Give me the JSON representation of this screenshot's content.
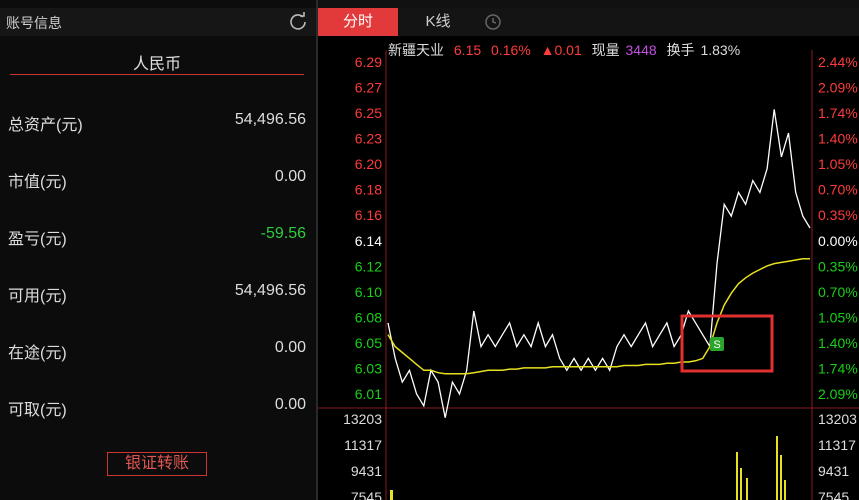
{
  "account": {
    "title": "账号信息",
    "currency": "人民币",
    "rows": [
      {
        "label": "总资产(元)",
        "value": "54,496.56",
        "color": "normal"
      },
      {
        "label": "市值(元)",
        "value": "0.00",
        "color": "normal"
      },
      {
        "label": "盈亏(元)",
        "value": "-59.56",
        "color": "green"
      },
      {
        "label": "可用(元)",
        "value": "54,496.56",
        "color": "normal"
      },
      {
        "label": "在途(元)",
        "value": "0.00",
        "color": "normal"
      },
      {
        "label": "可取(元)",
        "value": "0.00",
        "color": "normal"
      }
    ],
    "transfer_button": "银证转账"
  },
  "tabs": [
    {
      "label": "分时",
      "active": true
    },
    {
      "label": "K线",
      "active": false
    }
  ],
  "quote": {
    "name": "新疆天业",
    "price": "6.15",
    "change_pct": "0.16%",
    "change": "▲0.01",
    "volume_label": "现量",
    "volume": "3448",
    "turnover_label": "换手",
    "turnover": "1.83%"
  },
  "price_axis": [
    "6.29",
    "6.27",
    "6.25",
    "6.23",
    "6.20",
    "6.18",
    "6.16",
    "6.14",
    "6.12",
    "6.10",
    "6.08",
    "6.05",
    "6.03",
    "6.01"
  ],
  "pct_axis": [
    "2.44%",
    "2.09%",
    "1.74%",
    "1.40%",
    "1.05%",
    "0.70%",
    "0.35%",
    "0.00%",
    "0.35%",
    "0.70%",
    "1.05%",
    "1.40%",
    "1.74%",
    "2.09%"
  ],
  "volume_axis": [
    "13203",
    "11317",
    "9431",
    "7545"
  ],
  "sell_marker": "S",
  "colors": {
    "up": "#ff3b3b",
    "down": "#16d116",
    "neutral": "#ffffff",
    "accent": "#e23a3a",
    "avg_line": "#e8e020",
    "price_line": "#ffffff",
    "volume_bar": "#e8e020",
    "highlight_box": "#e03030"
  },
  "chart_data": {
    "type": "line",
    "series": [
      {
        "values": [
          6.07,
          6.04,
          6.02,
          6.03,
          6.01,
          6.0,
          6.03,
          6.02,
          5.99,
          6.02,
          6.01,
          6.03,
          6.08,
          6.05,
          6.06,
          6.05,
          6.06,
          6.07,
          6.05,
          6.06,
          6.05,
          6.07,
          6.05,
          6.06,
          6.04,
          6.03,
          6.04,
          6.03,
          6.04,
          6.03,
          6.04,
          6.03,
          6.05,
          6.06,
          6.05,
          6.06,
          6.07,
          6.05,
          6.06,
          6.07,
          6.05,
          6.06,
          6.08,
          6.07,
          6.06,
          6.05,
          6.12,
          6.17,
          6.16,
          6.18,
          6.17,
          6.19,
          6.18,
          6.2,
          6.25,
          6.21,
          6.23,
          6.18,
          6.16,
          6.15
        ]
      },
      {
        "values": [
          6.06,
          6.05,
          6.045,
          6.04,
          6.035,
          6.03,
          6.03,
          6.028,
          6.027,
          6.027,
          6.027,
          6.027,
          6.028,
          6.029,
          6.03,
          6.03,
          6.03,
          6.031,
          6.031,
          6.032,
          6.032,
          6.032,
          6.032,
          6.033,
          6.033,
          6.033,
          6.033,
          6.033,
          6.033,
          6.033,
          6.033,
          6.033,
          6.033,
          6.034,
          6.034,
          6.034,
          6.035,
          6.035,
          6.035,
          6.036,
          6.036,
          6.037,
          6.037,
          6.038,
          6.04,
          6.05,
          6.07,
          6.085,
          6.095,
          6.103,
          6.108,
          6.112,
          6.115,
          6.118,
          6.12,
          6.121,
          6.122,
          6.123,
          6.124,
          6.124
        ]
      }
    ],
    "ylim": [
      6.0,
      6.3
    ]
  }
}
